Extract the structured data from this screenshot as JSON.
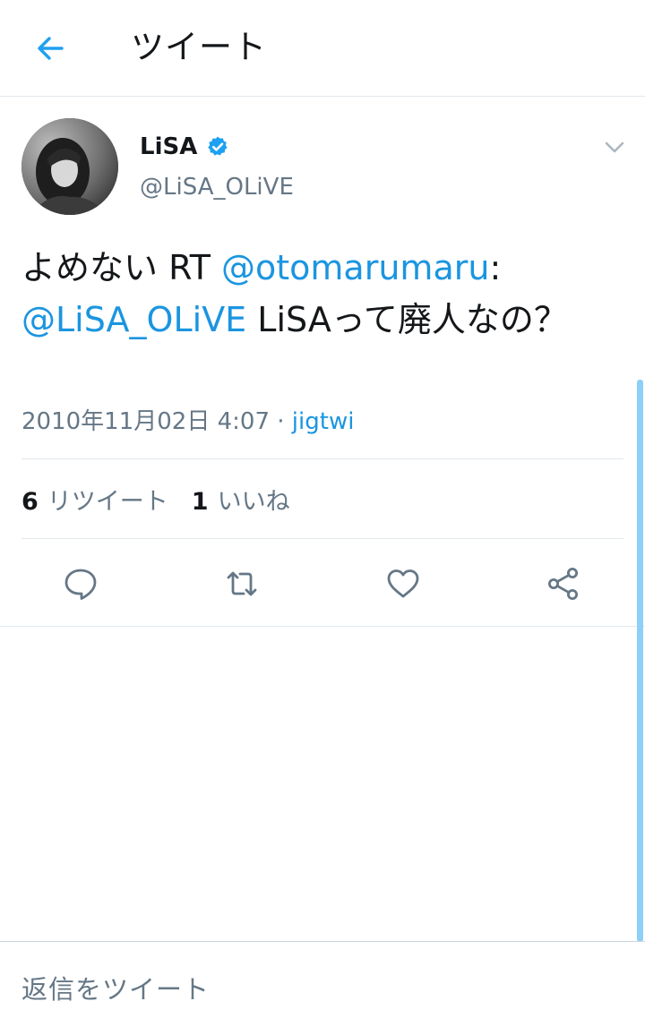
{
  "header": {
    "title": "ツイート",
    "back_icon": "arrow-left-icon",
    "accent_color": "#1da1f2"
  },
  "tweet": {
    "author": {
      "display_name": "LiSA",
      "handle": "@LiSA_OLiVE",
      "verified_icon": "verified-badge-icon"
    },
    "text": {
      "prefix": "よめない RT ",
      "mention1": "@otomarumaru",
      "colon": ":",
      "mention2": "@LiSA_OLiVE",
      "suffix": " LiSAって廃人なの？"
    },
    "timestamp": "2010年11月02日 4:07",
    "separator": " · ",
    "source": "jigtwi",
    "stats": {
      "retweets_count": "6",
      "retweets_label": "リツイート",
      "likes_count": "1",
      "likes_label": "いいね"
    },
    "actions": [
      "reply-icon",
      "retweet-icon",
      "like-icon",
      "share-icon"
    ]
  },
  "reply": {
    "placeholder": "返信をツイート"
  },
  "colors": {
    "link": "#1b95e0",
    "secondary_text": "#657786",
    "divider": "#e1e8ed"
  }
}
